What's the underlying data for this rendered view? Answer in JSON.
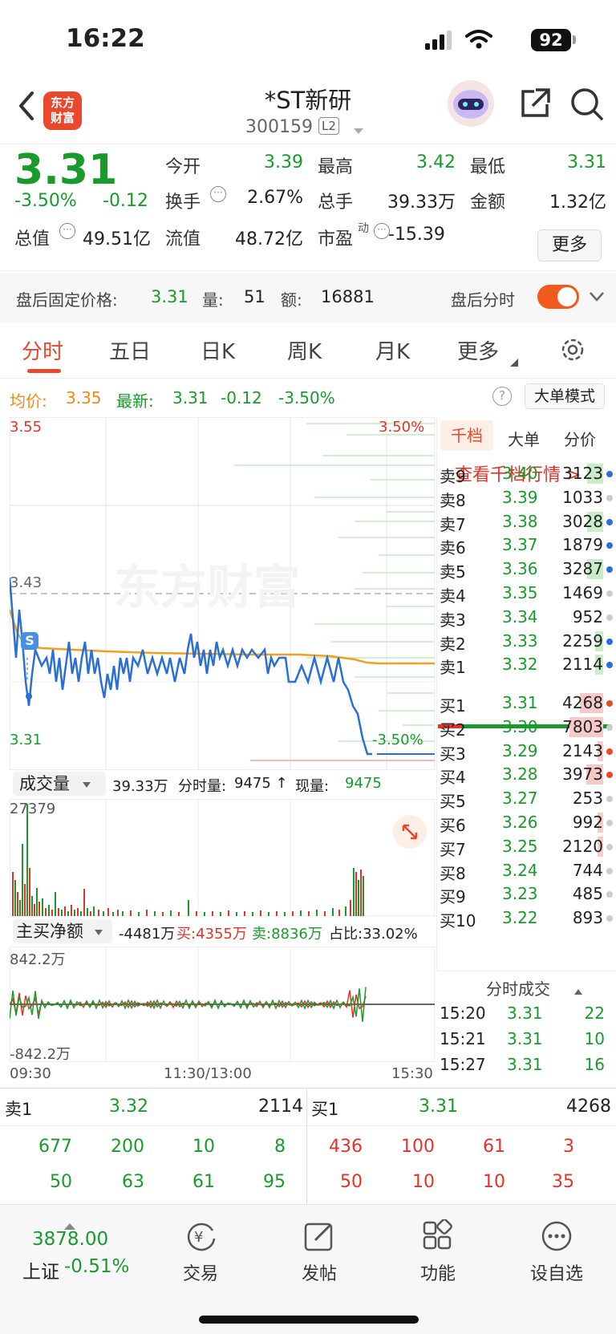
{
  "status": {
    "time": "16:22",
    "battery": "92"
  },
  "header": {
    "logo_line1": "东方",
    "logo_line2": "财富",
    "title": "*ST新研",
    "code": "300159",
    "level": "L2"
  },
  "quote": {
    "price": "3.31",
    "change_pct": "-3.50%",
    "change": "-0.12",
    "open_label": "今开",
    "open": "3.39",
    "high_label": "最高",
    "high": "3.42",
    "low_label": "最低",
    "low": "3.31",
    "turnover_label": "换手",
    "turnover": "2.67%",
    "volume_label": "总手",
    "volume": "39.33万",
    "amount_label": "金额",
    "amount": "1.32亿",
    "mktcap_label": "总值",
    "mktcap": "49.51亿",
    "float_label": "流值",
    "float": "48.72亿",
    "pe_label": "市盈",
    "pe_sup": "动",
    "pe": "-15.39",
    "more_label": "更多"
  },
  "afterhours": {
    "label": "盘后固定价格:",
    "price": "3.31",
    "vol_label": "量:",
    "vol": "51",
    "amt_label": "额:",
    "amt": "16881",
    "toggle_label": "盘后分时",
    "toggle_on": true
  },
  "tabs": [
    "分时",
    "五日",
    "日K",
    "周K",
    "月K",
    "更多"
  ],
  "avg": {
    "avg_label": "均价:",
    "avg": "3.35",
    "latest_label": "最新:",
    "latest": "3.31",
    "chg": "-0.12",
    "pct": "-3.50%",
    "mode_btn": "大单模式"
  },
  "chart": {
    "y_top": "3.55",
    "y_mid": "3.43",
    "y_bottom": "3.31",
    "pct_top": "3.50%",
    "pct_bottom": "-3.50%",
    "watermark": "东方财富",
    "s_marker": "S",
    "colors": {
      "price": "#2a6fd6",
      "avg": "#f0a020",
      "up": "#e2332b",
      "down": "#1a9a2c"
    }
  },
  "volume": {
    "selector": "成交量",
    "total": "39.33万",
    "fenshi_label": "分时量:",
    "fenshi": "9475 ↑",
    "now_label": "现量:",
    "now": "9475",
    "max": "27379"
  },
  "netbuy": {
    "selector": "主买净额",
    "net": "-4481万",
    "buy": "买:4355万",
    "sell": "卖:8836万",
    "ratio": "占比:33.02%",
    "top": "842.2万",
    "bottom": "-842.2万"
  },
  "time_axis": {
    "start": "09:30",
    "mid": "11:30/13:00",
    "end": "15:30"
  },
  "orderbook": {
    "tabs": [
      "千档",
      "大单",
      "分价"
    ],
    "link": "查看千档行情 >",
    "asks": [
      {
        "name": "卖9",
        "price": "3.40",
        "vol": "3123",
        "fill": 0.28,
        "dot": "#2a6fd6"
      },
      {
        "name": "卖8",
        "price": "3.39",
        "vol": "1033",
        "fill": 0.0,
        "dot": "#ccc"
      },
      {
        "name": "卖7",
        "price": "3.38",
        "vol": "3028",
        "fill": 0.28,
        "dot": "#2a6fd6"
      },
      {
        "name": "卖6",
        "price": "3.37",
        "vol": "1879",
        "fill": 0.0,
        "dot": "#2a6fd6"
      },
      {
        "name": "卖5",
        "price": "3.36",
        "vol": "3287",
        "fill": 0.28,
        "dot": "#2a6fd6"
      },
      {
        "name": "卖4",
        "price": "3.35",
        "vol": "1469",
        "fill": 0.0,
        "dot": "#ccc"
      },
      {
        "name": "卖3",
        "price": "3.34",
        "vol": "952",
        "fill": 0.0,
        "dot": "#ccc"
      },
      {
        "name": "卖2",
        "price": "3.33",
        "vol": "2259",
        "fill": 0.14,
        "dot": "#2a6fd6"
      },
      {
        "name": "卖1",
        "price": "3.32",
        "vol": "2114",
        "fill": 0.14,
        "dot": "#2a6fd6"
      }
    ],
    "bids": [
      {
        "name": "买1",
        "price": "3.31",
        "vol": "4268",
        "fill": 0.42,
        "dot": "#e8482c"
      },
      {
        "name": "买2",
        "price": "3.30",
        "vol": "7803",
        "fill": 0.6,
        "dot": "#ccc"
      },
      {
        "name": "买3",
        "price": "3.29",
        "vol": "2143",
        "fill": 0.1,
        "dot": "#e8482c"
      },
      {
        "name": "买4",
        "price": "3.28",
        "vol": "3973",
        "fill": 0.3,
        "dot": "#e8482c"
      },
      {
        "name": "买5",
        "price": "3.27",
        "vol": "253",
        "fill": 0.0,
        "dot": "#ccc"
      },
      {
        "name": "买6",
        "price": "3.26",
        "vol": "992",
        "fill": 0.1,
        "dot": "#ccc"
      },
      {
        "name": "买7",
        "price": "3.25",
        "vol": "2120",
        "fill": 0.1,
        "dot": "#ccc"
      },
      {
        "name": "买8",
        "price": "3.24",
        "vol": "744",
        "fill": 0.0,
        "dot": "#ccc"
      },
      {
        "name": "买9",
        "price": "3.23",
        "vol": "485",
        "fill": 0.0,
        "dot": "#ccc"
      },
      {
        "name": "买10",
        "price": "3.22",
        "vol": "893",
        "fill": 0.0,
        "dot": "#ccc"
      }
    ],
    "ticks_title": "分时成交",
    "ticks": [
      {
        "time": "15:20",
        "price": "3.31",
        "vol": "22"
      },
      {
        "time": "15:21",
        "price": "3.31",
        "vol": "10"
      },
      {
        "time": "15:27",
        "price": "3.31",
        "vol": "16"
      }
    ]
  },
  "bottom_table": {
    "ask_label": "卖1",
    "ask_price": "3.32",
    "ask_vol": "2114",
    "bid_label": "买1",
    "bid_price": "3.31",
    "bid_vol": "4268",
    "ask_rows": [
      [
        "677",
        "200",
        "10",
        "8"
      ],
      [
        "50",
        "63",
        "61",
        "95"
      ]
    ],
    "bid_rows": [
      [
        "436",
        "100",
        "61",
        "3"
      ],
      [
        "50",
        "10",
        "10",
        "35"
      ]
    ]
  },
  "navbar": {
    "index_value": "3878.00",
    "index_name": "上证",
    "index_pct": "-0.51%",
    "items": [
      "交易",
      "发帖",
      "功能",
      "设自选"
    ]
  }
}
